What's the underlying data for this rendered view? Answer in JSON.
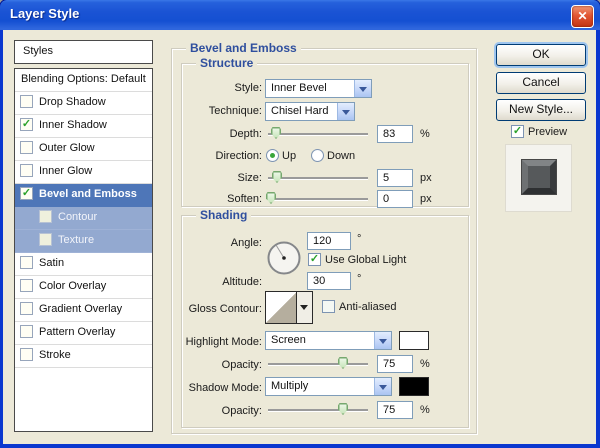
{
  "window": {
    "title": "Layer Style",
    "close_icon": "✕"
  },
  "sidebar": {
    "header": "Styles",
    "items": [
      {
        "label": "Blending Options: Default",
        "has_checkbox": false,
        "checked": false,
        "selected": false,
        "sub": false
      },
      {
        "label": "Drop Shadow",
        "has_checkbox": true,
        "checked": false,
        "selected": false,
        "sub": false
      },
      {
        "label": "Inner Shadow",
        "has_checkbox": true,
        "checked": true,
        "selected": false,
        "sub": false
      },
      {
        "label": "Outer Glow",
        "has_checkbox": true,
        "checked": false,
        "selected": false,
        "sub": false
      },
      {
        "label": "Inner Glow",
        "has_checkbox": true,
        "checked": false,
        "selected": false,
        "sub": false
      },
      {
        "label": "Bevel and Emboss",
        "has_checkbox": true,
        "checked": true,
        "selected": true,
        "sub": false
      },
      {
        "label": "Contour",
        "has_checkbox": true,
        "checked": false,
        "selected": false,
        "sub": true
      },
      {
        "label": "Texture",
        "has_checkbox": true,
        "checked": false,
        "selected": false,
        "sub": true
      },
      {
        "label": "Satin",
        "has_checkbox": true,
        "checked": false,
        "selected": false,
        "sub": false
      },
      {
        "label": "Color Overlay",
        "has_checkbox": true,
        "checked": false,
        "selected": false,
        "sub": false
      },
      {
        "label": "Gradient Overlay",
        "has_checkbox": true,
        "checked": false,
        "selected": false,
        "sub": false
      },
      {
        "label": "Pattern Overlay",
        "has_checkbox": true,
        "checked": false,
        "selected": false,
        "sub": false
      },
      {
        "label": "Stroke",
        "has_checkbox": true,
        "checked": false,
        "selected": false,
        "sub": false
      }
    ]
  },
  "panel": {
    "title": "Bevel and Emboss",
    "structure": {
      "title": "Structure",
      "style_label": "Style:",
      "style_value": "Inner Bevel",
      "technique_label": "Technique:",
      "technique_value": "Chisel Hard",
      "depth_label": "Depth:",
      "depth_value": "83",
      "depth_unit": "%",
      "direction_label": "Direction:",
      "direction_up": "Up",
      "direction_down": "Down",
      "direction_selected": "Up",
      "size_label": "Size:",
      "size_value": "5",
      "size_unit": "px",
      "soften_label": "Soften:",
      "soften_value": "0",
      "soften_unit": "px"
    },
    "shading": {
      "title": "Shading",
      "angle_label": "Angle:",
      "angle_value": "120",
      "angle_unit": "°",
      "use_global_light": "Use Global Light",
      "use_global_light_checked": true,
      "altitude_label": "Altitude:",
      "altitude_value": "30",
      "altitude_unit": "°",
      "gloss_label": "Gloss Contour:",
      "anti_aliased": "Anti-aliased",
      "anti_aliased_checked": false,
      "highlight_label": "Highlight Mode:",
      "highlight_value": "Screen",
      "highlight_color": "#ffffff",
      "opacity_label": "Opacity:",
      "highlight_opacity": "75",
      "opacity_unit": "%",
      "shadow_label": "Shadow Mode:",
      "shadow_value": "Multiply",
      "shadow_color": "#000000",
      "shadow_opacity": "75"
    }
  },
  "actions": {
    "ok": "OK",
    "cancel": "Cancel",
    "new_style": "New Style...",
    "preview": "Preview",
    "preview_checked": true
  },
  "colors": {
    "titlebar": "#1a53d4",
    "dialog_bg": "#ece9d8",
    "selected_row": "#4e76b8",
    "sub_row": "#93a9d0",
    "group_title": "#2f4f9e",
    "check_green": "#2aa12a",
    "highlight_swatch": "#ffffff",
    "shadow_swatch": "#000000"
  }
}
